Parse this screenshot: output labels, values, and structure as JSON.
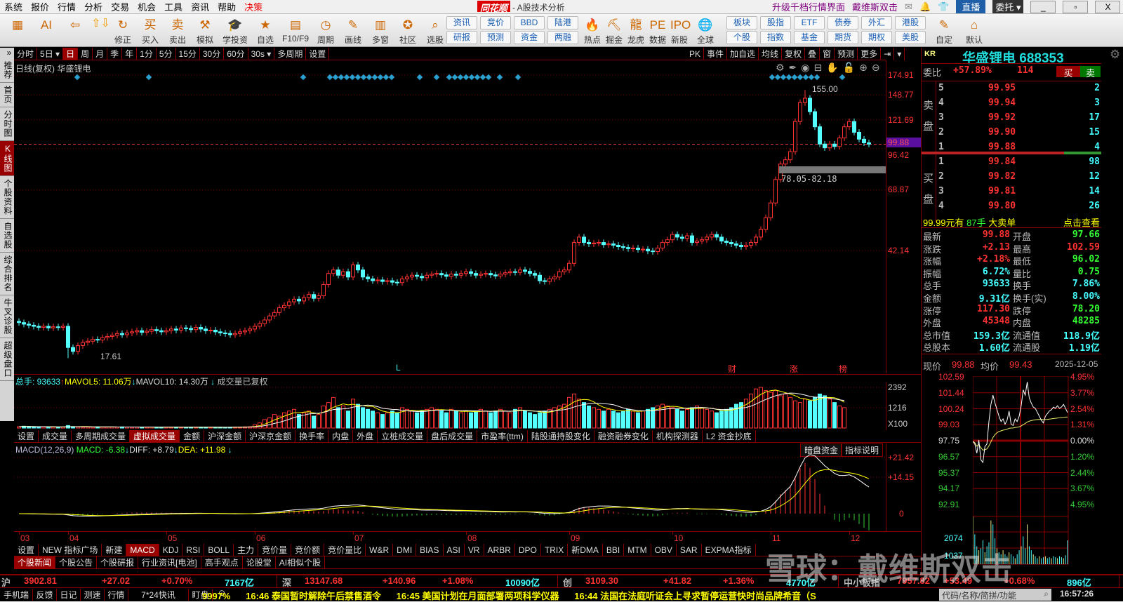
{
  "menu": {
    "items": [
      "系统",
      "报价",
      "行情",
      "分析",
      "交易",
      "机会",
      "工具",
      "资讯",
      "帮助",
      "决策"
    ],
    "brand": "同花顺",
    "title": "- A股技术分析",
    "upgrade": "升级千档行情界面",
    "user": "戴维斯双击",
    "live": "直播",
    "order": "委托",
    "min": "_",
    "restore": "▫",
    "close": "X"
  },
  "toolbar": {
    "icons": [
      {
        "label": "",
        "icon": "▦",
        "name": "app-grid"
      },
      {
        "label": "",
        "icon": "AI",
        "name": "ai-assistant"
      },
      {
        "label": "",
        "icon": "⇦",
        "name": "back"
      },
      {
        "label": "修正",
        "icon": "↻",
        "name": "revise"
      },
      {
        "label": "买入",
        "icon": "买",
        "name": "buy"
      },
      {
        "label": "卖出",
        "icon": "卖",
        "name": "sell"
      },
      {
        "label": "模拟",
        "icon": "⚒",
        "name": "simulate"
      },
      {
        "label": "学投资",
        "icon": "🎓",
        "name": "learn"
      },
      {
        "label": "自选",
        "icon": "★",
        "name": "watchlist"
      },
      {
        "label": "F10/F9",
        "icon": "▤",
        "name": "f10"
      },
      {
        "label": "周期",
        "icon": "◷",
        "name": "period"
      },
      {
        "label": "画线",
        "icon": "✎",
        "name": "draw"
      },
      {
        "label": "多窗",
        "icon": "▥",
        "name": "multiwindow"
      },
      {
        "label": "社区",
        "icon": "✪",
        "name": "community"
      },
      {
        "label": "选股",
        "icon": "⌕",
        "name": "stock-picker"
      }
    ],
    "pairs1": [
      [
        "资讯",
        "研报"
      ],
      [
        "竞价",
        "预测"
      ],
      [
        "BBD",
        "资金"
      ],
      [
        "陆港",
        "两融"
      ]
    ],
    "icons2": [
      {
        "label": "热点",
        "icon": "🔥",
        "name": "hot"
      },
      {
        "label": "掘金",
        "icon": "⛏",
        "name": "dig"
      },
      {
        "label": "龙虎",
        "icon": "龍",
        "name": "dragon-tiger"
      },
      {
        "label": "数据",
        "icon": "PE",
        "name": "data"
      },
      {
        "label": "新股",
        "icon": "IPO",
        "name": "ipo"
      },
      {
        "label": "全球",
        "icon": "🌐",
        "name": "global"
      }
    ],
    "pairs2": [
      [
        "板块",
        "个股"
      ],
      [
        "股指",
        "指数"
      ],
      [
        "ETF",
        "基金"
      ],
      [
        "债券",
        "期货"
      ],
      [
        "外汇",
        "期权"
      ],
      [
        "港股",
        "美股"
      ]
    ],
    "icons3": [
      {
        "label": "自定",
        "icon": "✎",
        "name": "custom"
      },
      {
        "label": "默认",
        "icon": "⌂",
        "name": "default"
      }
    ]
  },
  "leftnav": [
    "推荐",
    "首页",
    "分时图",
    "K线图",
    "个股资料",
    "自选股",
    "综合排名",
    "牛叉诊股",
    "超级盘口"
  ],
  "periods": [
    "分时",
    "5日 ▾",
    "日",
    "周",
    "月",
    "季",
    "年",
    "1分",
    "5分",
    "15分",
    "30分",
    "60分",
    "30s ▾",
    "多周期",
    "设置"
  ],
  "period_active": 2,
  "period_right": [
    "PK",
    "事件",
    "加自选",
    "均线",
    "复权",
    "叠",
    "窗",
    "预测",
    "更多",
    "⇥",
    "▾"
  ],
  "main": {
    "title": "日线(复权)  华盛锂电",
    "price_labels": [
      "174.91",
      "148.77",
      "121.69",
      "96.42",
      "68.87",
      "42.14"
    ],
    "current_label": "99.88",
    "high_label": "155.00",
    "low_label": "17.61",
    "range_label": "78.05-82.18",
    "markers": [
      "L",
      "财",
      "涨",
      "榜"
    ]
  },
  "chart_data": {
    "type": "candlestick",
    "scale": "log",
    "ylim": [
      16,
      180
    ],
    "months": [
      "03",
      "04",
      "05",
      "06",
      "07",
      "08",
      "09",
      "10",
      "11",
      "12"
    ],
    "month_start_index": [
      0,
      10,
      30,
      48,
      68,
      91,
      112,
      133,
      153,
      169
    ],
    "close": [
      23.5,
      23.2,
      23,
      22.8,
      22.6,
      22.8,
      22.5,
      22.7,
      22.6,
      22.8,
      19.2,
      18.6,
      19.5,
      20,
      20.2,
      20.5,
      20.4,
      20.8,
      21,
      21.2,
      21.5,
      21.3,
      21.6,
      21.8,
      22,
      21.7,
      21.9,
      22.2,
      22,
      21.8,
      22,
      22.3,
      22.1,
      22.5,
      22.4,
      22.2,
      22.6,
      22.3,
      22,
      22.1,
      21.8,
      21.6,
      21.5,
      21.3,
      21.5,
      21.8,
      22,
      22.3,
      22.8,
      23.3,
      24,
      24.8,
      25.5,
      26.5,
      27,
      27.8,
      28.4,
      28,
      28.8,
      29.5,
      28.6,
      29.2,
      32,
      35,
      36,
      34.5,
      35.5,
      34,
      37.5,
      36,
      34,
      33.5,
      33,
      33.2,
      32.8,
      33,
      32.6,
      32.5,
      33.5,
      34,
      34.5,
      34.2,
      33.8,
      34.5,
      34.8,
      35,
      34.6,
      34.2,
      34.8,
      34.5,
      35,
      35.5,
      35,
      34.5,
      34.8,
      35,
      34.6,
      34.3,
      34.8,
      35.2,
      35.5,
      35.3,
      36,
      35.6,
      35,
      34.5,
      33,
      32.8,
      33.5,
      34,
      35.5,
      36,
      38,
      45,
      47,
      45,
      44.5,
      44.8,
      45,
      44.2,
      44.5,
      44,
      43.5,
      43.2,
      42.8,
      43,
      42.5,
      42.6,
      42,
      41.8,
      43,
      45,
      46,
      48,
      47,
      46.5,
      47.5,
      45,
      45.5,
      46,
      47,
      48,
      47,
      45.5,
      45,
      44.5,
      44,
      43.5,
      44,
      45,
      47,
      50,
      55,
      62,
      75,
      85,
      88,
      94,
      120,
      140,
      145,
      130,
      115,
      100,
      97,
      100,
      98,
      105,
      115,
      120,
      110,
      104,
      101,
      99.88
    ],
    "volume": [
      80,
      110,
      90,
      70,
      60,
      70,
      60,
      65,
      55,
      60,
      150,
      90,
      70,
      60,
      60,
      55,
      70,
      60,
      60,
      65,
      60,
      70,
      60,
      55,
      60,
      50,
      55,
      60,
      50,
      50,
      55,
      50,
      60,
      50,
      45,
      50,
      55,
      50,
      45,
      50,
      45,
      50,
      45,
      50,
      55,
      60,
      70,
      80,
      200,
      300,
      500,
      600,
      800,
      700,
      900,
      1000,
      1100,
      800,
      900,
      1000,
      700,
      800,
      1300,
      1500,
      1800,
      1200,
      1300,
      1000,
      1700,
      1400,
      1200,
      1100,
      1000,
      900,
      800,
      900,
      1000,
      900,
      1200,
      1100,
      1000,
      900,
      1000,
      1100,
      1200,
      1100,
      1000,
      900,
      1100,
      1000,
      900,
      1000,
      900,
      1000,
      1100,
      1000,
      900,
      1000,
      1100,
      1000,
      900,
      1100,
      1200,
      1000,
      900,
      800,
      900,
      1000,
      1100,
      1200,
      1300,
      1400,
      1800,
      2000,
      1700,
      1500,
      1300,
      1200,
      1100,
      1000,
      1100,
      1000,
      900,
      1000,
      1100,
      1000,
      900,
      1000,
      1100,
      1200,
      1300,
      1400,
      1300,
      1200,
      1100,
      1000,
      1100,
      1200,
      1300,
      1200,
      1100,
      1000,
      900,
      1000,
      1100,
      1200,
      1400,
      1500,
      1700,
      2000,
      2300,
      2392,
      2200,
      2100,
      2200,
      1900,
      2000,
      1800,
      1600,
      1500,
      1700,
      1600,
      1800,
      2000,
      1900,
      1700,
      1500,
      1300,
      1200
    ]
  },
  "volume": {
    "label_total": "总手: 93633",
    "ma5": "MAVOL5: 11.06万",
    "ma10": "MAVOL10: 14.30万",
    "note": "成交量已复权",
    "axis": [
      "2392",
      "1216",
      "X100"
    ]
  },
  "vol_tabs": [
    "设置",
    "成交量",
    "多周期成交量",
    "虚拟成交量",
    "金额",
    "沪深金额",
    "沪深京金额",
    "换手率",
    "内盘",
    "外盘",
    "立桩成交量",
    "盘后成交量",
    "市盈率(ttm)",
    "陆股通持股变化",
    "融资融券变化",
    "机构探测器",
    "L2 资金抄底"
  ],
  "vol_tab_active": 3,
  "macd": {
    "name": "MACD(12,26,9)",
    "macd": "MACD: -6.38",
    "diff": "DIFF: +8.79",
    "dea": "DEA: +11.98",
    "axis": [
      "+21.42",
      "+14.15",
      "0"
    ],
    "btn1": "暗盘资金",
    "btn2": "指标说明"
  },
  "ind_tabs": [
    "设置",
    "NEW 指标广场",
    "新建",
    "MACD",
    "KDJ",
    "RSI",
    "BOLL",
    "主力",
    "竞价量",
    "竞价额",
    "竞价量比",
    "W&R",
    "DMI",
    "BIAS",
    "ASI",
    "VR",
    "ARBR",
    "DPO",
    "TRIX",
    "新DMA",
    "BBI",
    "MTM",
    "OBV",
    "SAR",
    "EXPMA指标"
  ],
  "ind_tab_active": 3,
  "news_tabs": [
    "个股新闻",
    "个股公告",
    "个股研报",
    "行业资讯[电池]",
    "高手观点",
    "论股堂",
    "AI相似个股"
  ],
  "quote": {
    "kr": "KR",
    "name": "华盛锂电 688353",
    "webi_label": "委比",
    "webi": "+57.89%",
    "weicha": "114",
    "buy": "买",
    "sell": "卖",
    "ask_label": "卖盘",
    "bid_label": "买盘",
    "asks": [
      [
        "5",
        "99.95",
        "2"
      ],
      [
        "4",
        "99.94",
        "3"
      ],
      [
        "3",
        "99.92",
        "17"
      ],
      [
        "2",
        "99.90",
        "15"
      ],
      [
        "1",
        "99.88",
        "4"
      ]
    ],
    "bids": [
      [
        "1",
        "99.84",
        "98"
      ],
      [
        "2",
        "99.82",
        "12"
      ],
      [
        "3",
        "99.81",
        "14"
      ],
      [
        "4",
        "99.80",
        "26"
      ]
    ],
    "big_price": "99.99元有",
    "big_qty": "87手",
    "big_text": "大卖单",
    "big_link": "点击查看",
    "stats": [
      [
        "最新",
        "99.88",
        "red",
        "开盘",
        "97.66",
        "green"
      ],
      [
        "涨跌",
        "+2.13",
        "red",
        "最高",
        "102.59",
        "red"
      ],
      [
        "涨幅",
        "+2.18%",
        "red",
        "最低",
        "96.02",
        "green"
      ],
      [
        "振幅",
        "6.72%",
        "cyan",
        "量比",
        "0.75",
        "green"
      ],
      [
        "总手",
        "93633",
        "cyan",
        "换手",
        "7.86%",
        "cyan"
      ],
      [
        "金额",
        "9.31亿",
        "cyan",
        "换手(实)",
        "8.00%",
        "cyan"
      ],
      [
        "涨停",
        "117.30",
        "red",
        "跌停",
        "78.20",
        "green"
      ],
      [
        "外盘",
        "45348",
        "red",
        "内盘",
        "48285",
        "green"
      ],
      [
        "总市值",
        "159.3亿",
        "cyan",
        "流通值",
        "118.9亿",
        "cyan"
      ],
      [
        "总股本",
        "1.60亿",
        "cyan",
        "流通股",
        "1.19亿",
        "cyan"
      ]
    ]
  },
  "intraday": {
    "now_label": "现价",
    "now": "99.88",
    "avg_label": "均价",
    "avg": "99.43",
    "date": "2025-12-05",
    "left": [
      "102.59",
      "101.44",
      "100.24",
      "99.03",
      "97.75",
      "96.57",
      "95.37",
      "94.17",
      "92.91"
    ],
    "right": [
      "4.95%",
      "3.77%",
      "2.54%",
      "1.31%",
      "0.00%",
      "1.20%",
      "2.44%",
      "3.67%",
      "4.95%"
    ],
    "vol_axis": [
      "2074",
      "1037"
    ],
    "ylim": [
      92.91,
      102.59
    ],
    "prices": [
      97.7,
      97.5,
      96.8,
      97.8,
      96.3,
      96.1,
      97.3,
      97.5,
      99.2,
      100.5,
      101.2,
      100.6,
      100.1,
      99.6,
      99.2,
      99.4,
      99.0,
      99.3,
      100.0,
      99.0,
      98.9,
      99.4,
      99.2,
      99.6,
      100.4,
      101.6,
      101.2,
      102.2,
      101.0,
      100.6,
      100.3,
      100.2,
      99.9,
      99.6,
      99.3,
      99.1,
      99.6,
      99.8,
      100.0,
      100.1,
      100.3,
      100.2,
      100.4,
      100.2,
      100.3,
      100.5,
      100.2,
      99.88
    ],
    "volumes": [
      2400,
      1500,
      900,
      700,
      800,
      1200,
      600,
      900,
      1100,
      2200,
      2000,
      1300,
      800,
      600,
      500,
      700,
      500,
      400,
      600,
      500,
      400,
      300,
      500,
      700,
      900,
      1400,
      800,
      2000,
      900,
      700,
      500,
      400,
      300,
      400,
      300,
      350,
      400,
      300,
      350,
      300,
      400,
      350,
      300,
      400,
      350,
      300,
      450,
      1200
    ]
  },
  "indices": [
    {
      "name": "沪",
      "value": "3902.81",
      "chg": "+27.02",
      "pct": "+0.70%",
      "amt": "7167亿"
    },
    {
      "name": "深",
      "value": "13147.68",
      "chg": "+140.96",
      "pct": "+1.08%",
      "amt": "10090亿"
    },
    {
      "name": "创",
      "value": "3109.30",
      "chg": "+41.82",
      "pct": "+1.36%",
      "amt": "4770亿"
    },
    {
      "name": "中小板指",
      "value": "7957.82",
      "chg": "+53.49",
      "pct": "+0.68%",
      "amt": "896亿"
    }
  ],
  "bottom": {
    "links": [
      "手机端",
      "反馈",
      "日记",
      "测速",
      "行情",
      "7*24快讯",
      "盯盘"
    ],
    "ticker": "9997%      16:46 泰国暂时解除午后禁售酒令      16:45 美国计划在月面部署两项科学仪器      16:44 法国在法庭听证会上寻求暂停运营快时尚品牌希音（S",
    "search_placeholder": "代码/名称/简拼/功能",
    "clock": "16:57:26"
  },
  "watermark": "雪球：戴维斯双击"
}
